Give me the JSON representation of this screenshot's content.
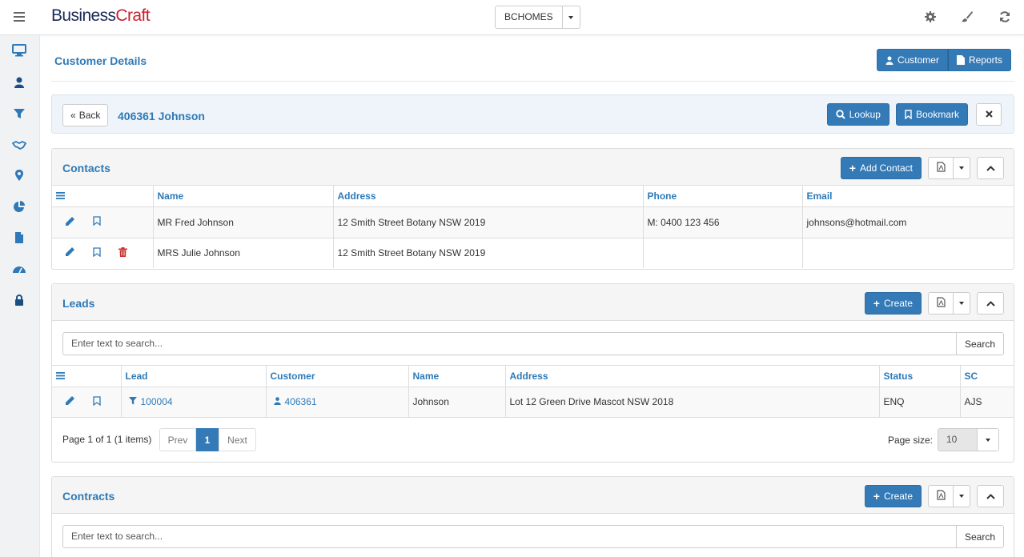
{
  "app": {
    "logo_part1": "Business",
    "logo_part2": "Craft",
    "environment": "BCHOMES"
  },
  "page": {
    "title": "Customer Details",
    "customer_button": "Customer",
    "reports_button": "Reports",
    "back_button": "Back",
    "customer_name": "406361 Johnson",
    "lookup_button": "Lookup",
    "bookmark_button": "Bookmark"
  },
  "contacts": {
    "title": "Contacts",
    "add_button": "Add Contact",
    "columns": [
      "Name",
      "Address",
      "Phone",
      "Email"
    ],
    "rows": [
      {
        "name": "MR Fred Johnson",
        "address": "12 Smith Street Botany NSW 2019",
        "phone": "M: 0400 123 456",
        "email": "johnsons@hotmail.com",
        "deletable": false
      },
      {
        "name": "MRS Julie Johnson",
        "address": "12 Smith Street Botany NSW 2019",
        "phone": "",
        "email": "",
        "deletable": true
      }
    ]
  },
  "leads": {
    "title": "Leads",
    "create_button": "Create",
    "search_placeholder": "Enter text to search...",
    "search_button": "Search",
    "columns": [
      "Lead",
      "Customer",
      "Name",
      "Address",
      "Status",
      "SC"
    ],
    "rows": [
      {
        "lead": "100004",
        "customer": "406361",
        "name": "Johnson",
        "address": "Lot 12 Green Drive Mascot NSW 2018",
        "status": "ENQ",
        "sc": "AJS"
      }
    ],
    "pager": {
      "info": "Page 1 of 1 (1 items)",
      "prev": "Prev",
      "current": "1",
      "next": "Next",
      "page_size_label": "Page size:",
      "page_size": "10"
    }
  },
  "contracts": {
    "title": "Contracts",
    "create_button": "Create",
    "search_placeholder": "Enter text to search...",
    "search_button": "Search"
  },
  "colors": {
    "primary": "#337ab7",
    "link": "#2e7ab8",
    "danger": "#c9302c",
    "logo_dark": "#1b2a56",
    "logo_red": "#c8202f"
  }
}
